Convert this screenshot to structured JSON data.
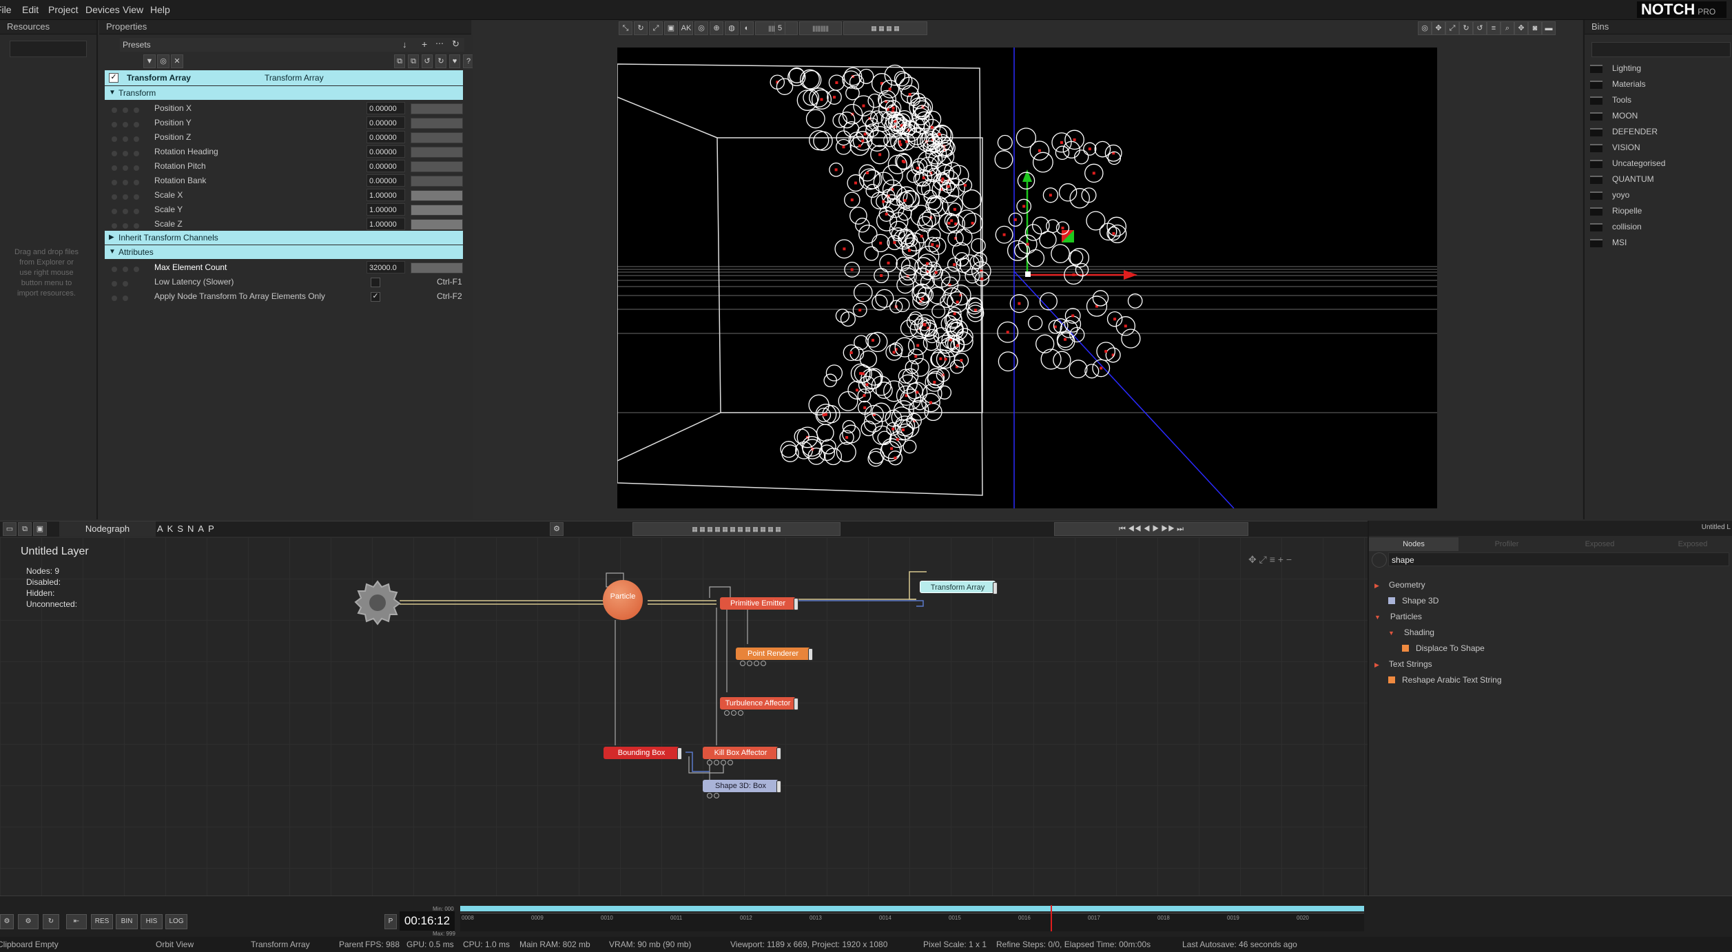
{
  "menu": {
    "file": "File",
    "edit": "Edit",
    "project": "Project",
    "devices": "Devices",
    "view": "View",
    "help": "Help"
  },
  "logo": {
    "brand": "NOTCH",
    "edition": "PRO"
  },
  "resources": {
    "title": "Resources",
    "hint": "Drag and drop files from Explorer or use right mouse button menu to import resources."
  },
  "properties": {
    "title": "Properties",
    "presets": "Presets",
    "node_name": "Transform Array",
    "node_type": "Transform Array",
    "sections": {
      "transform": "Transform",
      "inherit": "Inherit Transform Channels",
      "attributes": "Attributes"
    },
    "transform_rows": [
      {
        "label": "Position X",
        "value": "0.00000",
        "fill": 0
      },
      {
        "label": "Position Y",
        "value": "0.00000",
        "fill": 0
      },
      {
        "label": "Position Z",
        "value": "0.00000",
        "fill": 0
      },
      {
        "label": "Rotation Heading",
        "value": "0.00000",
        "fill": 0
      },
      {
        "label": "Rotation Pitch",
        "value": "0.00000",
        "fill": 0
      },
      {
        "label": "Rotation Bank",
        "value": "0.00000",
        "fill": 0
      },
      {
        "label": "Scale X",
        "value": "1.00000",
        "fill": 1
      },
      {
        "label": "Scale Y",
        "value": "1.00000",
        "fill": 1
      },
      {
        "label": "Scale Z",
        "value": "1.00000",
        "fill": 1
      }
    ],
    "attributes": {
      "max_element_count": {
        "label": "Max Element Count",
        "value": "32000.0"
      },
      "low_latency": {
        "label": "Low Latency (Slower)",
        "shortcut": "Ctrl-F1",
        "checked": false
      },
      "apply_node_transform": {
        "label": "Apply Node Transform To Array Elements Only",
        "shortcut": "Ctrl-F2",
        "checked": true
      }
    }
  },
  "viewport": {
    "toolbar_number": "5"
  },
  "bins": {
    "title": "Bins",
    "items": [
      "Lighting",
      "Materials",
      "Tools",
      "MOON",
      "DEFENDER",
      "VISION",
      "Uncategorised",
      "QUANTUM",
      "yoyo",
      "Riopelle",
      "collision",
      "MSI"
    ]
  },
  "nodegraph": {
    "tab": "Nodegraph",
    "toolbar_letters": [
      "A",
      "K",
      "S",
      "N",
      "A",
      "P"
    ],
    "layer_title": "Untitled  Layer",
    "stats": {
      "nodes_label": "Nodes:",
      "nodes_value": "9",
      "disabled": "Disabled:",
      "hidden": "Hidden:",
      "unconnected": "Unconnected:"
    },
    "nodes": {
      "particle": "Particle",
      "primitive_emitter": "Primitive  Emitter",
      "transform_array": "Transform  Array",
      "point_renderer": "Point  Renderer",
      "turbulence_affector": "Turbulence  Affector",
      "bounding_box": "Bounding  Box",
      "kill_box_affector": "Kill  Box  Affector",
      "shape_3d_box": "Shape  3D:  Box"
    }
  },
  "nodes_panel": {
    "tabs": [
      "Nodes",
      "Profiler",
      "Exposed",
      "Exposed"
    ],
    "search_value": "shape",
    "top_right_label": "Untitled L",
    "tree": [
      {
        "label": "Geometry",
        "level": 0,
        "color": ""
      },
      {
        "label": "Shape 3D",
        "level": 1,
        "color": "#aab4d8"
      },
      {
        "label": "Particles",
        "level": 0,
        "color": ""
      },
      {
        "label": "Shading",
        "level": 1,
        "color": ""
      },
      {
        "label": "Displace To Shape",
        "level": 2,
        "color": "#f08a40"
      },
      {
        "label": "Text Strings",
        "level": 0,
        "color": ""
      },
      {
        "label": "Reshape Arabic Text String",
        "level": 1,
        "color": "#f08a40"
      }
    ]
  },
  "timeline": {
    "timecode": "00:16:12",
    "min": "Min: 000",
    "max": "Max: 999",
    "ticks": [
      "0008",
      "0009",
      "0010",
      "0011",
      "0012",
      "0013",
      "0014",
      "0015",
      "0016",
      "0017",
      "0018",
      "0019",
      "0020"
    ],
    "buttons": [
      "RES",
      "BIN",
      "HIS",
      "LOG"
    ],
    "p_label": "P"
  },
  "status": {
    "clipboard": "Clipboard Empty",
    "mode": "Orbit View",
    "selected": "Transform Array",
    "parent": "Parent",
    "fps": "FPS: 988",
    "gpu": "GPU: 0.5 ms",
    "cpu": "CPU: 1.0 ms",
    "ram": "Main RAM: 802 mb",
    "vram": "VRAM: 90 mb (90 mb)",
    "viewport": "Viewport: 1189 x 669, Project: 1920 x 1080",
    "pixel_scale": "Pixel Scale: 1 x 1",
    "refine": "Refine Steps: 0/0, Elapsed Time: 00m:00s",
    "autosave": "Last Autosave: 46 seconds ago"
  },
  "colors": {
    "cyan_header": "#a9e6ee",
    "particle_node": "#e8774a",
    "emitter_node": "#e0553e",
    "renderer_node": "#e8843a",
    "box_node": "#d42a2a",
    "shape_node": "#aab4d8",
    "transform_node": "#b8ecec"
  }
}
